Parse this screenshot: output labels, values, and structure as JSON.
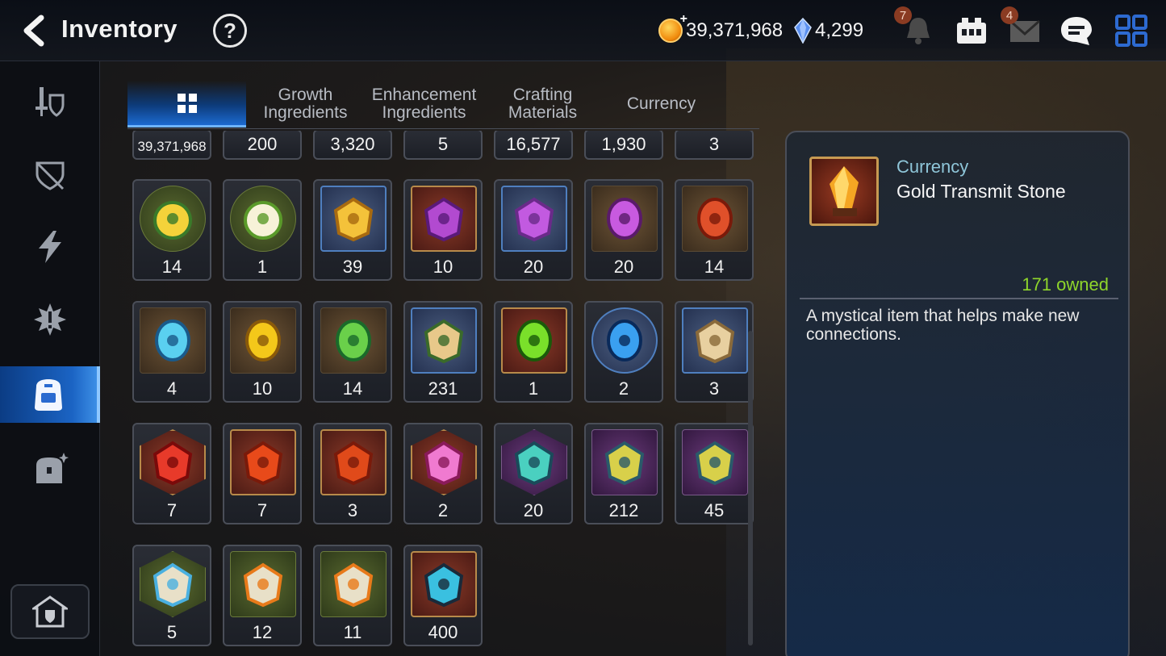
{
  "header": {
    "title": "Inventory",
    "help_label": "?",
    "gold": "39,371,968",
    "crystals": "4,299",
    "notifications_badge": "7",
    "mail_badge": "4"
  },
  "tabs": [
    {
      "label": "",
      "active": true
    },
    {
      "label": "Growth Ingredients"
    },
    {
      "label": "Enhancement Ingredients"
    },
    {
      "label": "Crafting Materials"
    },
    {
      "label": "Currency"
    }
  ],
  "top_row": [
    "39,371,968",
    "200",
    "3,320",
    "5",
    "16,577",
    "1,930",
    "3"
  ],
  "rows": [
    [
      {
        "qty": "14",
        "icon": "phantasma-owl-icon",
        "frame": "circle-green"
      },
      {
        "qty": "1",
        "icon": "leaf-owl-icon",
        "frame": "circle-green"
      },
      {
        "qty": "39",
        "icon": "golden-crystal-cluster-icon",
        "frame": "blue"
      },
      {
        "qty": "10",
        "icon": "purple-moon-gem-pentagon-icon",
        "frame": "red"
      },
      {
        "qty": "20",
        "icon": "purple-moon-gem-triangle-icon",
        "frame": "blue"
      },
      {
        "qty": "20",
        "icon": "purple-moon-rune-icon",
        "frame": "brown"
      },
      {
        "qty": "14",
        "icon": "red-swirl-rune-icon",
        "frame": "brown"
      }
    ],
    [
      {
        "qty": "4",
        "icon": "blue-rune-icon",
        "frame": "brown"
      },
      {
        "qty": "10",
        "icon": "yellow-rune-icon",
        "frame": "brown"
      },
      {
        "qty": "14",
        "icon": "green-rune-icon",
        "frame": "brown"
      },
      {
        "qty": "231",
        "icon": "ginseng-root-icon",
        "frame": "blue"
      },
      {
        "qty": "1",
        "icon": "green-orb-icon",
        "frame": "red"
      },
      {
        "qty": "2",
        "icon": "blue-circuit-orb-icon",
        "frame": "circle-blue"
      },
      {
        "qty": "3",
        "icon": "golden-chest-icon",
        "frame": "blue"
      }
    ],
    [
      {
        "qty": "7",
        "icon": "red-star-stone-icon",
        "frame": "hex-red"
      },
      {
        "qty": "7",
        "icon": "red-hammer-stone-icon",
        "frame": "red"
      },
      {
        "qty": "3",
        "icon": "red-bolt-stone-icon",
        "frame": "red"
      },
      {
        "qty": "2",
        "icon": "pink-potion-icon",
        "frame": "hex-red"
      },
      {
        "qty": "20",
        "icon": "teal-star-stone-icon",
        "frame": "hex-purple"
      },
      {
        "qty": "212",
        "icon": "yellow-hammer-stone-icon",
        "frame": "purple"
      },
      {
        "qty": "45",
        "icon": "yellow-bolt-stone-icon",
        "frame": "purple"
      }
    ],
    [
      {
        "qty": "5",
        "icon": "blue-star-white-stone-icon",
        "frame": "hex-green"
      },
      {
        "qty": "12",
        "icon": "orange-hammer-white-stone-icon",
        "frame": "green"
      },
      {
        "qty": "11",
        "icon": "orange-bolt-white-stone-icon",
        "frame": "green"
      },
      {
        "qty": "400",
        "icon": "dark-crystal-shard-icon",
        "frame": "red"
      }
    ]
  ],
  "detail": {
    "category": "Currency",
    "name": "Gold Transmit Stone",
    "owned": "171 owned",
    "description": "A mystical item that helps make new connections.",
    "icon": "gold-transmit-stone-icon"
  },
  "colors": {
    "accent_blue": "#1b64c4",
    "owned_green": "#8fd62b",
    "category_teal": "#8fc6d9"
  }
}
